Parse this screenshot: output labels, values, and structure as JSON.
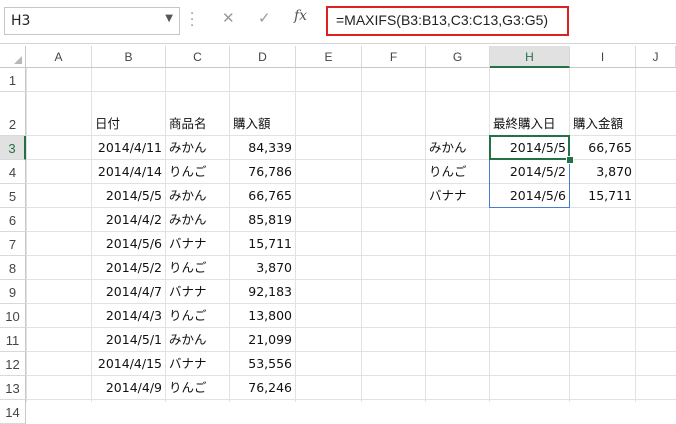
{
  "formula_bar": {
    "name_box": "H3",
    "formula": "=MAXIFS(B3:B13,C3:C13,G3:G5)",
    "cancel_icon": "✕",
    "enter_icon": "✓",
    "fx_label": "fx"
  },
  "columns": [
    "A",
    "B",
    "C",
    "D",
    "E",
    "F",
    "G",
    "H",
    "I",
    "J"
  ],
  "rows": [
    "1",
    "2",
    "3",
    "4",
    "5",
    "6",
    "7",
    "8",
    "9",
    "10",
    "11",
    "12",
    "13",
    "14"
  ],
  "headers": {
    "date": "日付",
    "product": "商品名",
    "amount": "購入額",
    "last_purchase": "最終購入日",
    "purchase_amount": "購入金額"
  },
  "data_rows": [
    {
      "date": "2014/4/11",
      "product": "みかん",
      "amount": "84,339"
    },
    {
      "date": "2014/4/14",
      "product": "りんご",
      "amount": "76,786"
    },
    {
      "date": "2014/5/5",
      "product": "みかん",
      "amount": "66,765"
    },
    {
      "date": "2014/4/2",
      "product": "みかん",
      "amount": "85,819"
    },
    {
      "date": "2014/5/6",
      "product": "バナナ",
      "amount": "15,711"
    },
    {
      "date": "2014/5/2",
      "product": "りんご",
      "amount": "3,870"
    },
    {
      "date": "2014/4/7",
      "product": "バナナ",
      "amount": "92,183"
    },
    {
      "date": "2014/4/3",
      "product": "りんご",
      "amount": "13,800"
    },
    {
      "date": "2014/5/1",
      "product": "みかん",
      "amount": "21,099"
    },
    {
      "date": "2014/4/15",
      "product": "バナナ",
      "amount": "53,556"
    },
    {
      "date": "2014/4/9",
      "product": "りんご",
      "amount": "76,246"
    }
  ],
  "summary_rows": [
    {
      "product": "みかん",
      "last_date": "2014/5/5",
      "amount": "66,765"
    },
    {
      "product": "りんご",
      "last_date": "2014/5/2",
      "amount": "3,870"
    },
    {
      "product": "バナナ",
      "last_date": "2014/5/6",
      "amount": "15,711"
    }
  ],
  "active_cell": {
    "column": "H",
    "row": "3"
  },
  "colors": {
    "selection": "#217346",
    "formula_highlight": "#e02020",
    "range_blue": "#4a7bd0",
    "range_green": "#3d9a52"
  }
}
